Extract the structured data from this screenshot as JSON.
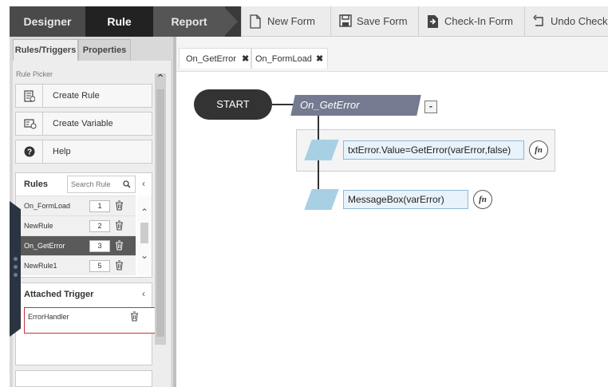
{
  "topbar": {
    "tabs": [
      "Designer",
      "Rule",
      "Report"
    ],
    "actions": {
      "new_form": "New Form",
      "save_form": "Save Form",
      "checkin_form": "Check-In Form",
      "undo_checkout": "Undo Checkout"
    }
  },
  "left_panel": {
    "tabs": {
      "rules_triggers": "Rules/Triggers",
      "properties": "Properties"
    },
    "picker_label": "Rule Picker",
    "picker_buttons": {
      "create_rule": "Create Rule",
      "create_variable": "Create Variable",
      "help": "Help"
    },
    "rules": {
      "title": "Rules",
      "search_placeholder": "Search Rule",
      "items": [
        {
          "name": "On_FormLoad",
          "number": "1"
        },
        {
          "name": "NewRule",
          "number": "2"
        },
        {
          "name": "On_GetError",
          "number": "3"
        },
        {
          "name": "NewRule1",
          "number": "5"
        }
      ]
    },
    "attached_trigger": {
      "title": "Attached Trigger",
      "item": "ErrorHandler"
    }
  },
  "canvas": {
    "tabs": [
      {
        "label": "On_GetError"
      },
      {
        "label": "On_FormLoad"
      }
    ],
    "start_label": "START",
    "rule_label": "On_GetError",
    "collapse_symbol": "-",
    "fn_label": "fn",
    "expressions": [
      "txtError.Value=GetError(varError,false)",
      "MessageBox(varError)"
    ]
  },
  "colors": {
    "selected_row": "#5a5a5a",
    "rule_header": "#747a8f",
    "trigger_border": "#c8323a",
    "action_shape": "#a8d0e4"
  }
}
